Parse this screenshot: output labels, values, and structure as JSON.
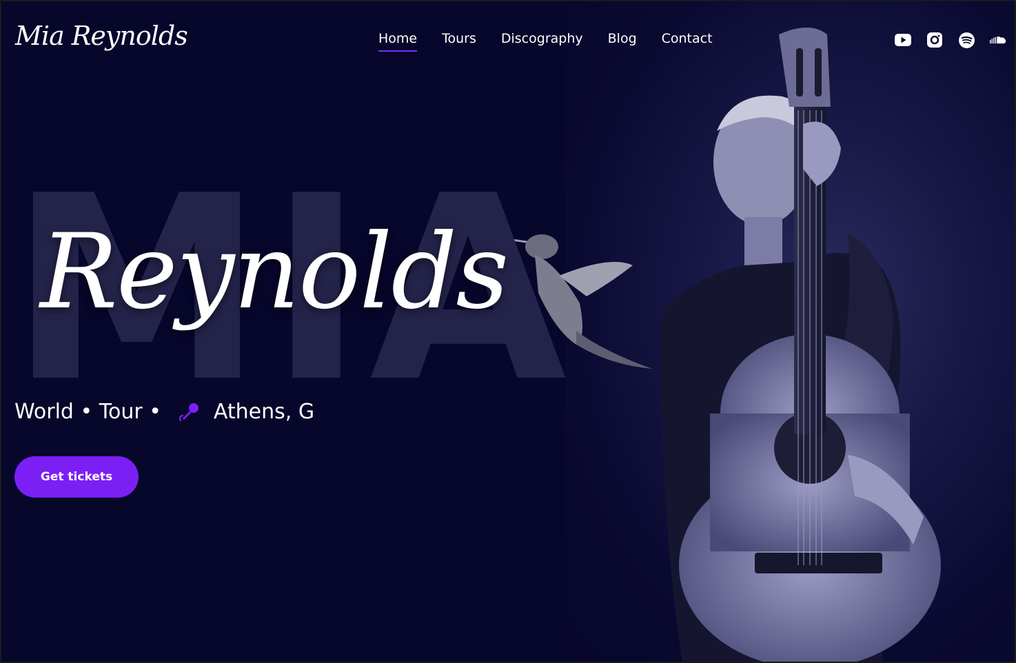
{
  "site": {
    "logo": "Mia Reynolds"
  },
  "nav": {
    "items": [
      {
        "label": "Home",
        "active": true
      },
      {
        "label": "Tours",
        "active": false
      },
      {
        "label": "Discography",
        "active": false
      },
      {
        "label": "Blog",
        "active": false
      },
      {
        "label": "Contact",
        "active": false
      }
    ]
  },
  "socials": [
    "youtube-icon",
    "instagram-icon",
    "spotify-icon",
    "soundcloud-icon"
  ],
  "hero": {
    "bg_word": "MIA",
    "script_title": "Reynolds",
    "tour_text": "World • Tour •",
    "location": "Athens, G",
    "cta_label": "Get tickets"
  },
  "colors": {
    "accent": "#7b1ff5",
    "background": "#07062b",
    "underline": "#7b2fff"
  }
}
